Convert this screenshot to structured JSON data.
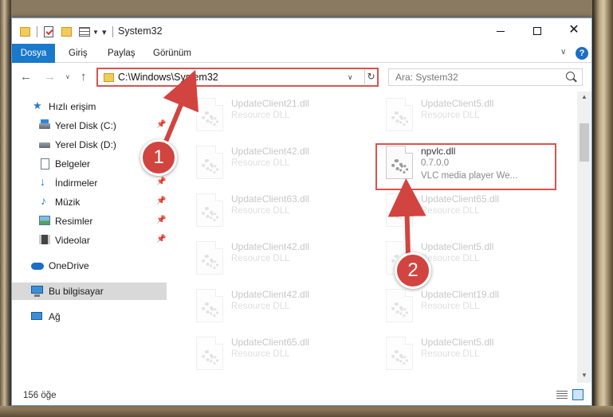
{
  "window": {
    "title": "System32",
    "min_label": "",
    "max_label": "",
    "close_label": "✕"
  },
  "ribbon": {
    "tabs": [
      "Dosya",
      "Giriş",
      "Paylaş",
      "Görünüm"
    ],
    "help": "?"
  },
  "nav": {
    "address": "C:\\Windows\\System32",
    "search_placeholder": "Ara: System32"
  },
  "sidebar": {
    "items": [
      {
        "label": "Hızlı erişim",
        "icon": "star-icon"
      },
      {
        "label": "Yerel Disk (C:)",
        "icon": "drive-c-icon",
        "pinned": true
      },
      {
        "label": "Yerel Disk (D:)",
        "icon": "drive-d-icon"
      },
      {
        "label": "Belgeler",
        "icon": "documents-icon"
      },
      {
        "label": "İndirmeler",
        "icon": "downloads-icon",
        "pinned": true
      },
      {
        "label": "Müzik",
        "icon": "music-icon",
        "pinned": true
      },
      {
        "label": "Resimler",
        "icon": "pictures-icon",
        "pinned": true
      },
      {
        "label": "Videolar",
        "icon": "videos-icon",
        "pinned": true
      },
      {
        "label": "OneDrive",
        "icon": "onedrive-icon"
      },
      {
        "label": "Bu bilgisayar",
        "icon": "this-pc-icon",
        "selected": true
      },
      {
        "label": "Ağ",
        "icon": "network-icon"
      }
    ]
  },
  "files": {
    "left_column": [
      {
        "name": "UpdateClient21.dll",
        "type": "Resource DLL"
      },
      {
        "name": "UpdateClient42.dll",
        "type": "Resource DLL"
      },
      {
        "name": "UpdateClient63.dll",
        "type": "Resource DLL"
      },
      {
        "name": "UpdateClient42.dll",
        "type": "Resource DLL"
      },
      {
        "name": "UpdateClient42.dll",
        "type": "Resource DLL"
      },
      {
        "name": "UpdateClient65.dll",
        "type": "Resource DLL"
      }
    ],
    "right_column": [
      {
        "name": "UpdateClient5.dll",
        "type": "Resource DLL"
      },
      {
        "name": "npvlc.dll",
        "version": "0.7.0.0",
        "type": "VLC media player We...",
        "highlighted": true
      },
      {
        "name": "UpdateClient65.dll",
        "type": "Resource DLL"
      },
      {
        "name": "UpdateClient5.dll",
        "type": "Resource DLL"
      },
      {
        "name": "UpdateClient19.dll",
        "type": "Resource DLL"
      },
      {
        "name": "UpdateClient5.dll",
        "type": "Resource DLL"
      }
    ]
  },
  "status": {
    "count": "156 öğe"
  },
  "callouts": {
    "one": "1",
    "two": "2"
  },
  "colors": {
    "accent": "#1979ca",
    "callout": "#d2443f",
    "highlight_border": "#d9534f"
  }
}
